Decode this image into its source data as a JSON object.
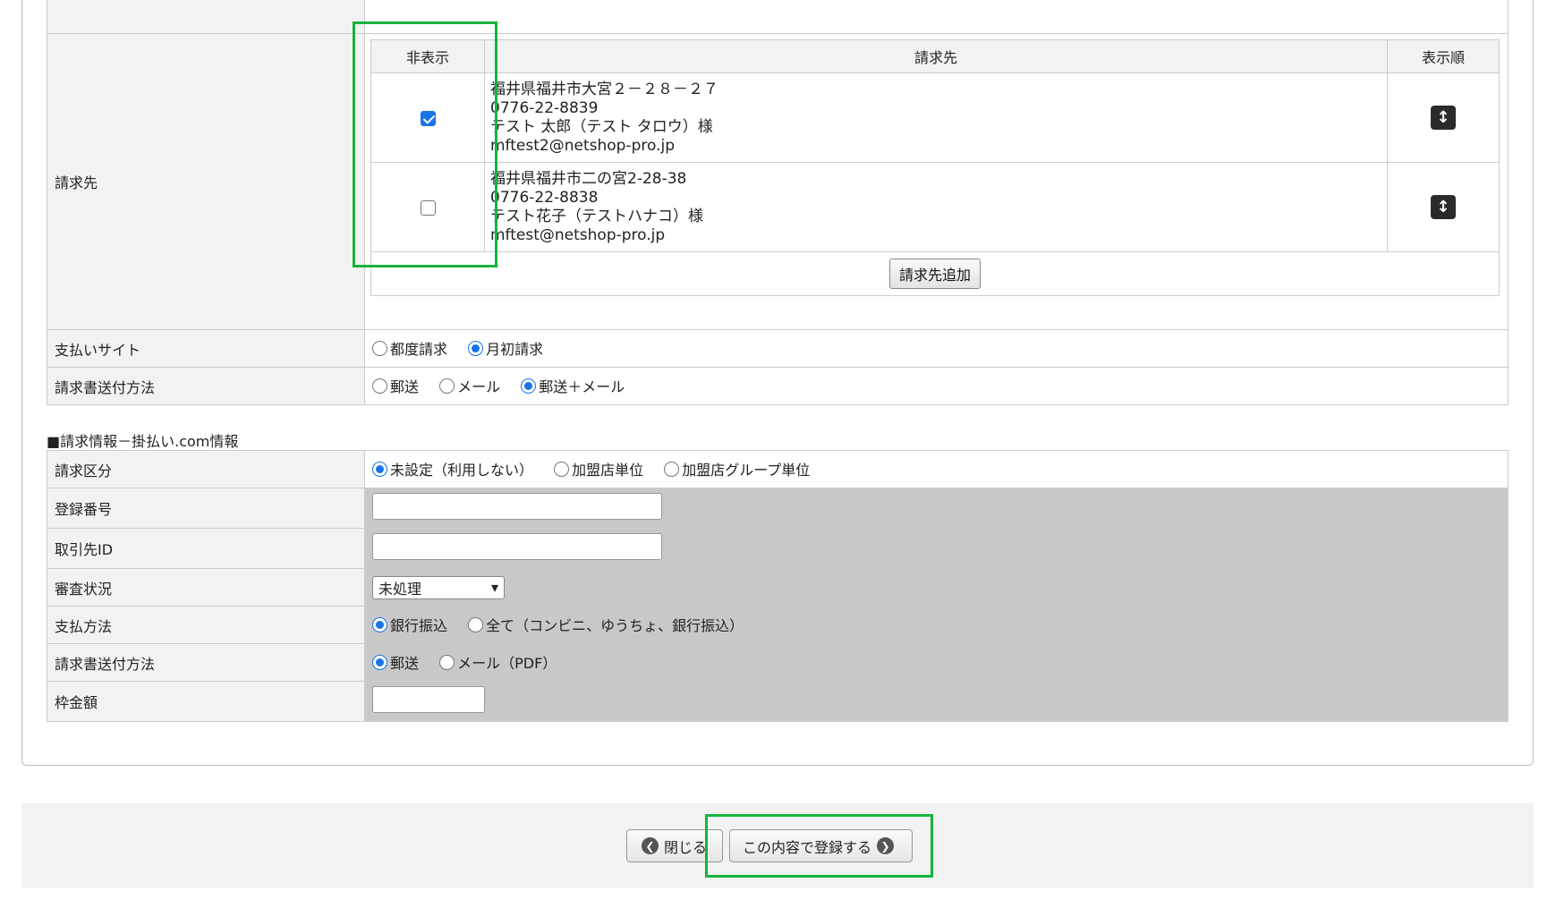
{
  "billing": {
    "label": "請求先",
    "headers": {
      "hide": "非表示",
      "address": "請求先",
      "order": "表示順"
    },
    "entries": [
      {
        "hidden": true,
        "address": "福井県福井市大宮２－２８－２７",
        "phone": "0776-22-8839",
        "name": "テスト 太郎（テスト タロウ）様",
        "email": "mftest2@netshop-pro.jp"
      },
      {
        "hidden": false,
        "address": "福井県福井市二の宮2-28-38",
        "phone": "0776-22-8838",
        "name": "テスト花子（テストハナコ）様",
        "email": "mftest@netshop-pro.jp"
      }
    ],
    "add_button": "請求先追加",
    "sort_icon": "↕"
  },
  "payment_site": {
    "label": "支払いサイト",
    "options": [
      {
        "label": "都度請求",
        "selected": false
      },
      {
        "label": "月初請求",
        "selected": true
      }
    ]
  },
  "invoice_delivery": {
    "label": "請求書送付方法",
    "options": [
      {
        "label": "郵送",
        "selected": false
      },
      {
        "label": "メール",
        "selected": false
      },
      {
        "label": "郵送＋メール",
        "selected": true
      }
    ]
  },
  "kakebarai": {
    "section_title": "■請求情報－掛払い.com情報",
    "billing_type": {
      "label": "請求区分",
      "options": [
        {
          "label": "未設定（利用しない）",
          "selected": true
        },
        {
          "label": "加盟店単位",
          "selected": false
        },
        {
          "label": "加盟店グループ単位",
          "selected": false
        }
      ]
    },
    "registration_number": {
      "label": "登録番号",
      "value": ""
    },
    "client_id": {
      "label": "取引先ID",
      "value": ""
    },
    "review_status": {
      "label": "審査状況",
      "selected": "未処理"
    },
    "payment_method": {
      "label": "支払方法",
      "options": [
        {
          "label": "銀行振込",
          "selected": true
        },
        {
          "label": "全て（コンビニ、ゆうちょ、銀行振込）",
          "selected": false
        }
      ]
    },
    "invoice_delivery": {
      "label": "請求書送付方法",
      "options": [
        {
          "label": "郵送",
          "selected": true
        },
        {
          "label": "メール（PDF）",
          "selected": false
        }
      ]
    },
    "credit_limit": {
      "label": "枠金額",
      "value": ""
    }
  },
  "footer": {
    "close_label": "閉じる",
    "submit_label": "この内容で登録する"
  },
  "colors": {
    "highlight": "#17b33a",
    "accent": "#1a73e8"
  }
}
